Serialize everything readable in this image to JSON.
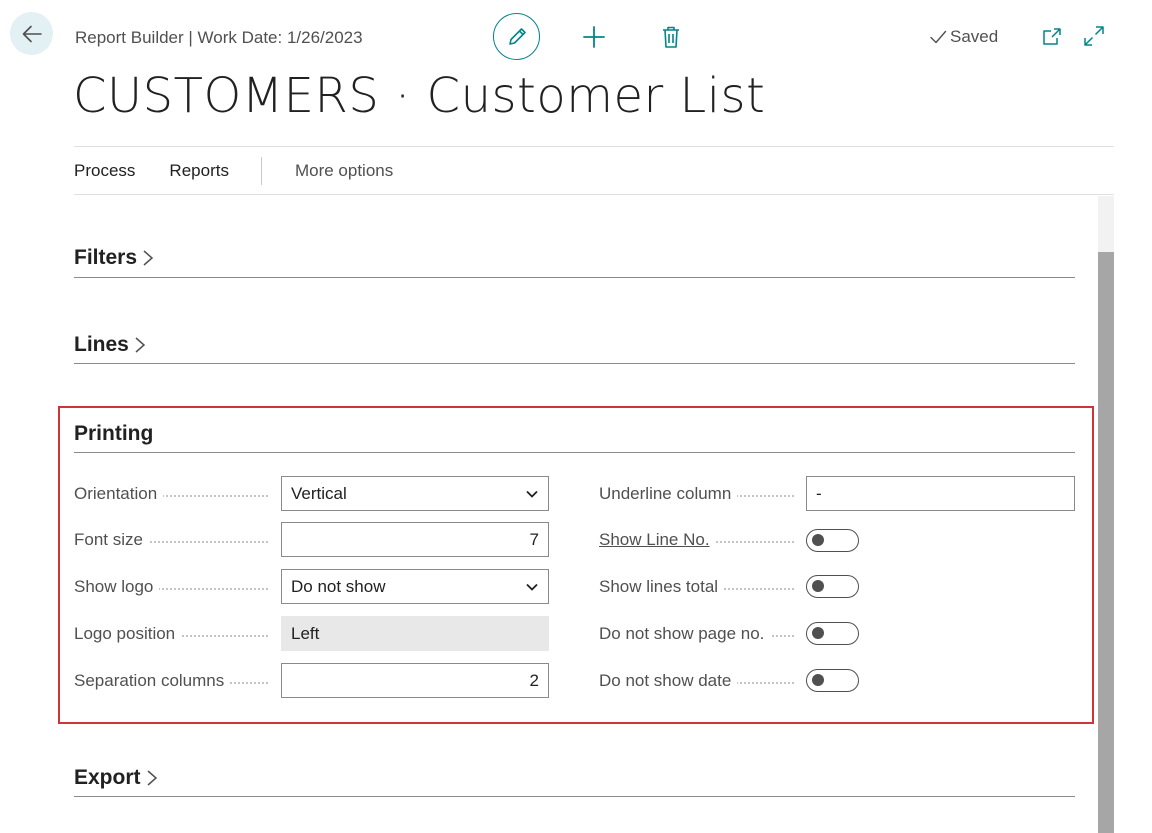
{
  "header": {
    "subtitle": "Report Builder | Work Date: 1/26/2023",
    "saved_label": "Saved",
    "title": "CUSTOMERS · Customer List"
  },
  "actions": {
    "process": "Process",
    "reports": "Reports",
    "more": "More options"
  },
  "sections": {
    "filters": "Filters",
    "lines": "Lines",
    "printing": "Printing",
    "export": "Export"
  },
  "printing": {
    "orientation_label": "Orientation",
    "orientation_value": "Vertical",
    "font_size_label": "Font size",
    "font_size_value": "7",
    "show_logo_label": "Show logo",
    "show_logo_value": "Do not show",
    "logo_position_label": "Logo position",
    "logo_position_value": "Left",
    "separation_columns_label": "Separation columns",
    "separation_columns_value": "2",
    "underline_column_label": "Underline column",
    "underline_column_value": "-",
    "show_line_no_label": "Show Line No.",
    "show_line_no_value": false,
    "show_lines_total_label": "Show lines total",
    "show_lines_total_value": false,
    "hide_page_no_label": "Do not show page no.",
    "hide_page_no_value": false,
    "hide_date_label": "Do not show date",
    "hide_date_value": false
  },
  "colors": {
    "accent": "#00858a",
    "highlight_border": "#d13438",
    "back_button_bg": "#e3f0f4"
  },
  "icons": {
    "back": "arrow-left-icon",
    "edit": "pencil-icon",
    "add": "plus-icon",
    "delete": "trash-icon",
    "saved": "checkmark-icon",
    "popout": "popout-icon",
    "expand": "expand-icon",
    "section": "chevron-right-icon",
    "select": "chevron-down-icon"
  }
}
